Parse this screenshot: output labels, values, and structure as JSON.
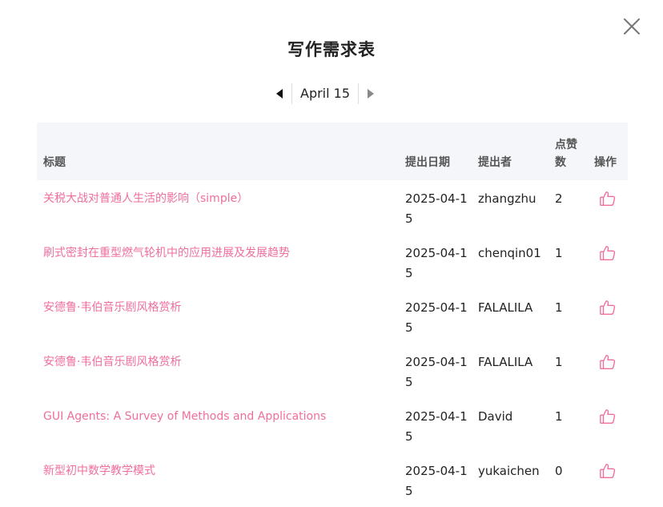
{
  "dialog": {
    "title": "写作需求表",
    "date": "April 15"
  },
  "table": {
    "headers": {
      "title": "标题",
      "date": "提出日期",
      "author": "提出者",
      "likes": "点赞数",
      "action": "操作"
    },
    "rows": [
      {
        "title": "关税大战对普通人生活的影响（simple）",
        "date": "2025-04-15",
        "author": "zhangzhu",
        "likes": "2"
      },
      {
        "title": "刷式密封在重型燃气轮机中的应用进展及发展趋势",
        "date": "2025-04-15",
        "author": "chenqin01",
        "likes": "1"
      },
      {
        "title": "安德鲁·韦伯音乐剧风格赏析",
        "date": "2025-04-15",
        "author": "FALALILA",
        "likes": "1"
      },
      {
        "title": "安德鲁·韦伯音乐剧风格赏析",
        "date": "2025-04-15",
        "author": "FALALILA",
        "likes": "1"
      },
      {
        "title": "GUI Agents: A Survey of Methods and Applications",
        "date": "2025-04-15",
        "author": "David",
        "likes": "1"
      },
      {
        "title": "新型初中数学教学模式",
        "date": "2025-04-15",
        "author": "yukaichen",
        "likes": "0"
      }
    ]
  },
  "colors": {
    "accent": "#f06e9e",
    "header_bg": "#f4f6fa"
  },
  "icons": {
    "close": "close-icon",
    "prev": "caret-left-icon",
    "next": "caret-right-icon",
    "like": "thumbs-up-icon"
  }
}
